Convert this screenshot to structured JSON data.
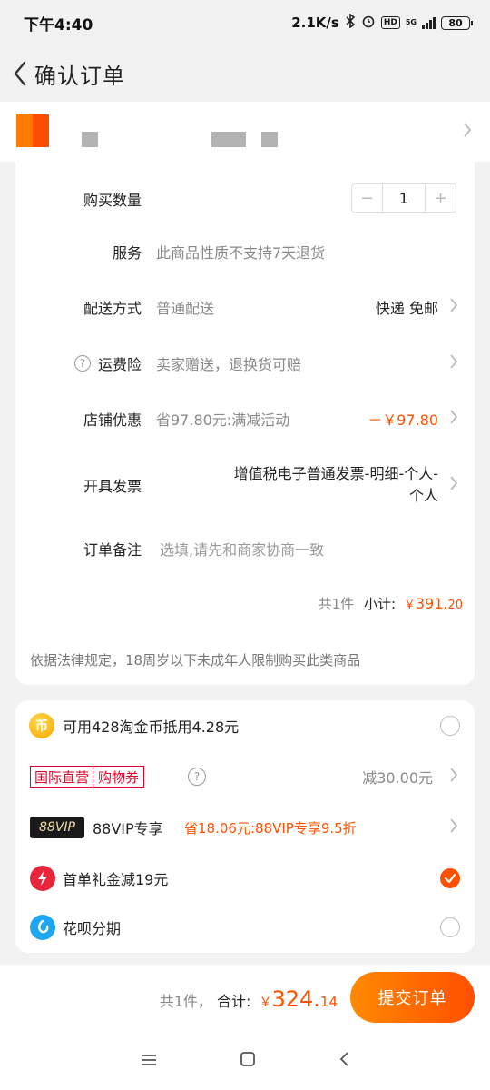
{
  "status_bar": {
    "time": "下午4:40",
    "network_speed": "2.1K/s",
    "hd_badge": "HD",
    "network_type": "5G",
    "battery": "80"
  },
  "nav": {
    "title": "确认订单",
    "back_icon": "chevron-left-icon"
  },
  "order": {
    "quantity_label": "购买数量",
    "quantity_minus": "−",
    "quantity": "1",
    "quantity_plus": "+",
    "service_label": "服务",
    "service_value": "此商品性质不支持7天退货",
    "delivery_label": "配送方式",
    "delivery_value": "普通配送",
    "delivery_right": "快递 免邮",
    "shipping_ins_label": "运费险",
    "shipping_ins_value": "卖家赠送，退换货可赔",
    "shop_discount_label": "店铺优惠",
    "shop_discount_value": "省97.80元:满减活动",
    "shop_discount_amount": "－￥97.80",
    "invoice_label": "开具发票",
    "invoice_value": "增值税电子普通发票-明细-个人-个人",
    "note_label": "订单备注",
    "note_placeholder": "选填,请先和商家协商一致",
    "subtotal_count": "共1件",
    "subtotal_label": "小计:",
    "subtotal_currency": "￥",
    "subtotal_int": "391.",
    "subtotal_dec": "20",
    "legal_notice": "依据法律规定，18周岁以下未成年人限制购买此类商品"
  },
  "benefits": {
    "coins_icon_text": "币",
    "coins_text": "可用428淘金币抵用4.28元",
    "intl_badge_left": "国际直营",
    "intl_badge_right": "购物券",
    "intl_value": "减30.00元",
    "vip_badge": "88VIP",
    "vip_label": "88VIP专享",
    "vip_value": "省18.06元:88VIP专享9.5折",
    "first_order_text": "首单礼金减19元",
    "huabei_text": "花呗分期"
  },
  "footer": {
    "count": "共1件，",
    "total_label": "合计:",
    "currency": "￥",
    "total_int": "324.",
    "total_dec": "14",
    "submit_label": "提交订单"
  },
  "colors": {
    "accent": "#ff5000",
    "button_gradient": [
      "#ff8a00",
      "#ff4f00"
    ]
  }
}
